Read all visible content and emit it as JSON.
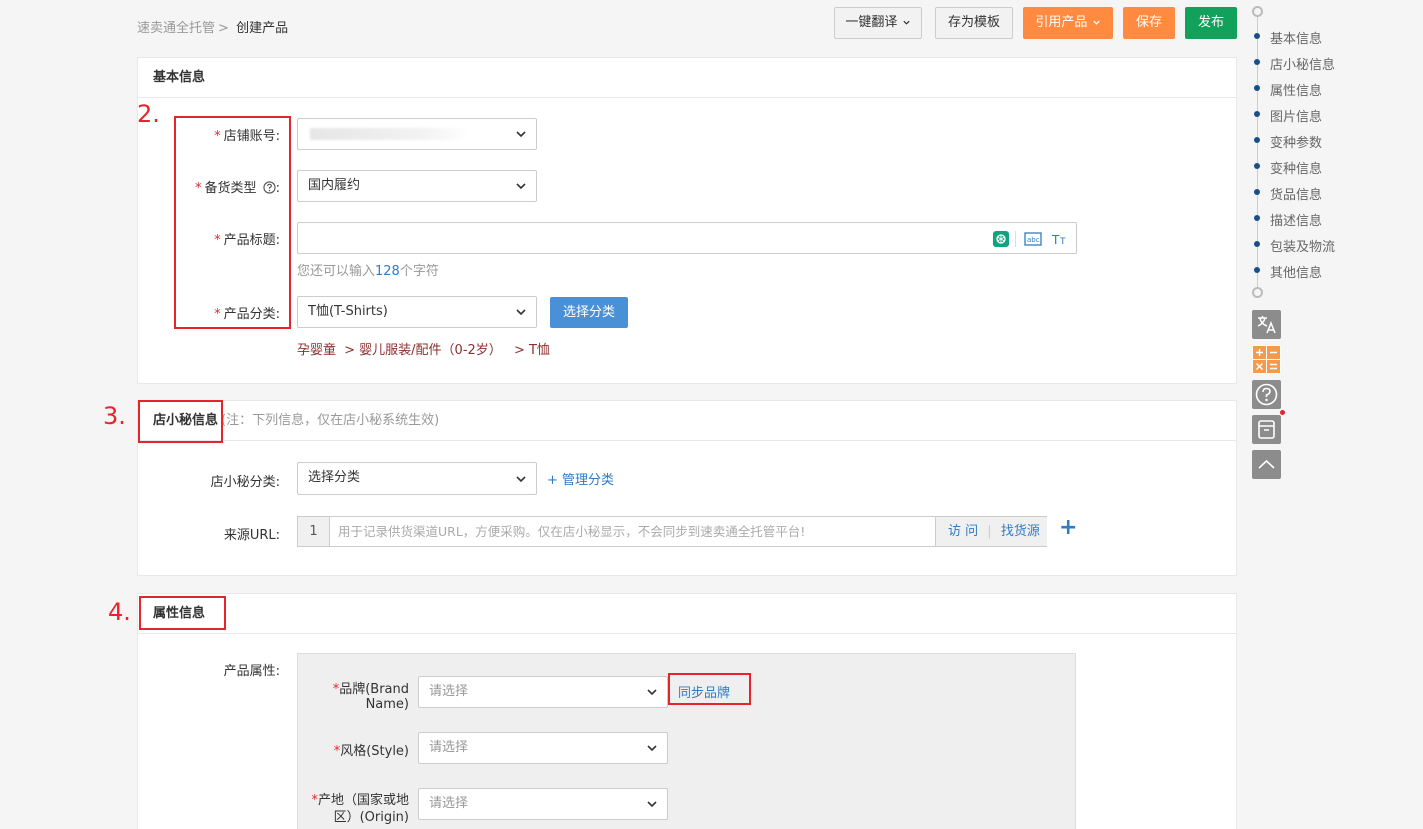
{
  "breadcrumb": {
    "parent": "速卖通全托管",
    "separator": ">",
    "current": "创建产品"
  },
  "toolbar": {
    "translate": "一键翻译",
    "save_template": "存为模板",
    "cite_product": "引用产品",
    "save": "保存",
    "publish": "发布"
  },
  "basic": {
    "title": "基本信息",
    "store_label": "店铺账号:",
    "stock_type_label": "备货类型",
    "stock_type_value": "国内履约",
    "product_title_label": "产品标题:",
    "char_hint_prefix": "您还可以输入",
    "char_hint_count": "128",
    "char_hint_suffix": "个字符",
    "category_label": "产品分类:",
    "category_value": "T恤(T-Shirts)",
    "select_category_button": "选择分类",
    "category_path_1": "孕婴童",
    "category_path_2": "> 婴儿服装/配件（0-2岁）",
    "category_path_3": "> T恤"
  },
  "dxm": {
    "title": "店小秘信息",
    "note": "(注：下列信息，仅在店小秘系统生效)",
    "category_label": "店小秘分类:",
    "category_placeholder": "选择分类",
    "manage_link": "+ 管理分类",
    "url_label": "来源URL:",
    "url_index": "1",
    "url_placeholder": "用于记录供货渠道URL，方便采购。仅在店小秘显示，不会同步到速卖通全托管平台!",
    "visit": "访 问",
    "divider": "|",
    "find_source": "找货源",
    "add": "+"
  },
  "attrs": {
    "title": "属性信息",
    "product_attr_label": "产品属性:",
    "brand_label_1": "品牌(Brand",
    "brand_label_2": "Name)",
    "brand_placeholder": "请选择",
    "sync_brand": "同步品牌",
    "style_label": "风格(Style)",
    "style_placeholder": "请选择",
    "origin_label_1": "产地（国家或地",
    "origin_label_2": "区）(Origin)",
    "origin_placeholder": "请选择",
    "required_mark": "*"
  },
  "annotations": {
    "n2": "2.",
    "n3": "3.",
    "n4": "4."
  },
  "right_nav": {
    "items": [
      "基本信息",
      "店小秘信息",
      "属性信息",
      "图片信息",
      "变种参数",
      "变种信息",
      "货品信息",
      "描述信息",
      "包装及物流",
      "其他信息"
    ]
  },
  "colors": {
    "orange": "#ff8a40",
    "green": "#11a15b",
    "blue_button": "#4a90d6",
    "red_annotation": "#e5242b",
    "nav_dot": "#1a4e8a"
  }
}
